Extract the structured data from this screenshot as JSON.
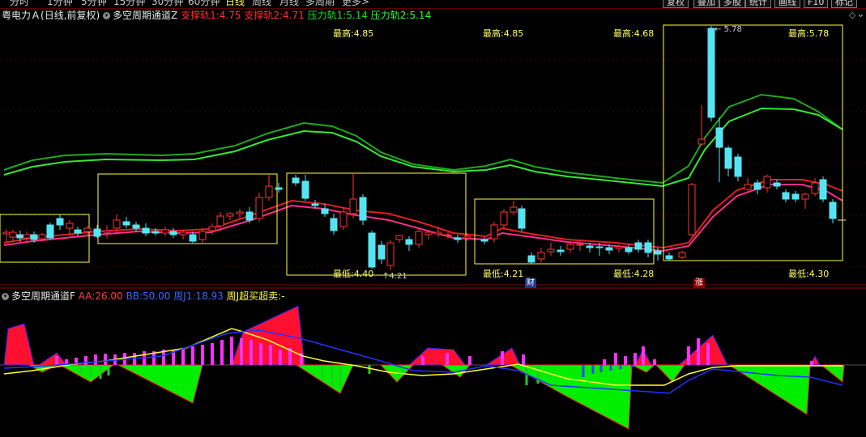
{
  "period_tabs": [
    "分时",
    "1分钟",
    "5分钟",
    "15分钟",
    "30分钟",
    "60分钟",
    "日线",
    "周线",
    "月线",
    "多周期",
    "更多>"
  ],
  "active_period": "日线",
  "right_buttons": [
    "复权",
    "叠加",
    "多股",
    "统计",
    "画线",
    "F10",
    "标记"
  ],
  "main_title": {
    "stock": "粤电力Ａ",
    "mode": "(日线,前复权)",
    "indicator": "多空周期通道Z",
    "s1_label": "支撑轨1:",
    "s1_value": "4.75",
    "s2_label": "支撑轨2:",
    "s2_value": "4.71",
    "p1_label": "压力轨1:",
    "p1_value": "5.14",
    "p2_label": "压力轨2:",
    "p2_value": "5.14"
  },
  "sub_title": {
    "indicator": "多空周期通道F",
    "aa_label": "AA:",
    "aa_value": "26.00",
    "bb_label": "BB:",
    "bb_value": "50.00",
    "zj_label": "周J1:",
    "zj_value": "18.93",
    "zc_label": "周J超买超卖:",
    "zc_value": "-"
  },
  "box_labels": {
    "high_1": "最高:4.85",
    "low_1": "最低:4.40",
    "high_2": "最高:4.85",
    "low_2": "最低:4.21",
    "high_3": "最高:4.68",
    "low_3": "最低:4.28",
    "high_4": "最高:5.78",
    "low_4": "最低:4.30"
  },
  "price_marks": {
    "peak": "5.78",
    "trough": "4.21"
  },
  "event_tags": {
    "finance": "财",
    "limit_up": "涨"
  },
  "colors": {
    "up": "#ff3333",
    "down": "#55e5f2",
    "green_band": "#22cc22",
    "red_band": "#ff3050",
    "box": "#ffff44",
    "panel_border": "#8b0000"
  }
}
